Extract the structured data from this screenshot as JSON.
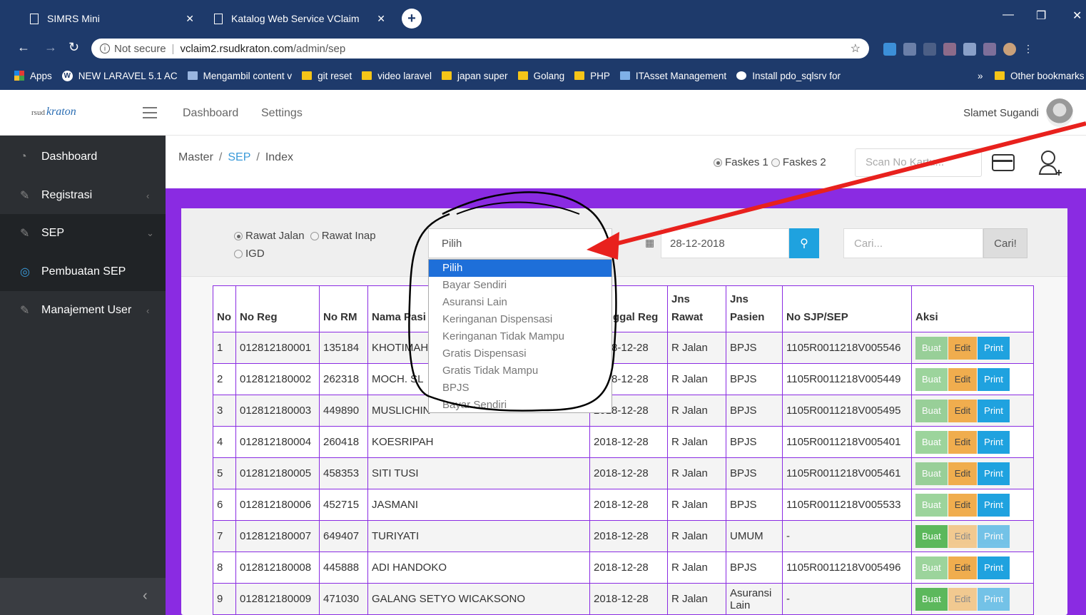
{
  "browser": {
    "tabs": [
      {
        "title": "SIMRS Mini"
      },
      {
        "title": "Katalog Web Service VClaim"
      }
    ],
    "address": {
      "security": "Not secure",
      "host": "vclaim2.rsudkraton.com",
      "path": "/admin/sep"
    },
    "bookmarks": [
      "Apps",
      "NEW LARAVEL 5.1 AC",
      "Mengambil content v",
      "git reset",
      "video laravel",
      "japan super",
      "Golang",
      "PHP",
      "ITAsset Management",
      "Install pdo_sqlsrv for"
    ],
    "other_bookmarks": "Other bookmarks",
    "overflow": "»"
  },
  "topnav": {
    "logo_small": "rsud",
    "logo": "kraton",
    "links": [
      "Dashboard",
      "Settings"
    ],
    "user": "Slamet Sugandi"
  },
  "sidebar": {
    "items": [
      {
        "label": "Dashboard"
      },
      {
        "label": "Registrasi"
      },
      {
        "label": "SEP"
      },
      {
        "label": "Pembuatan SEP"
      },
      {
        "label": "Manajement User"
      }
    ],
    "collapse": "‹"
  },
  "breadcrumb": {
    "master": "Master",
    "sep": "SEP",
    "index": "Index"
  },
  "faskes": {
    "options": [
      "Faskes 1",
      "Faskes 2"
    ],
    "selected": "Faskes 1"
  },
  "scan": {
    "placeholder": "Scan No Kartu..."
  },
  "filters": {
    "rawat": {
      "options": [
        "Rawat Jalan",
        "Rawat Inap",
        "IGD"
      ],
      "selected": "Rawat Jalan"
    },
    "select_value": "Pilih",
    "dropdown": [
      "Pilih",
      "Bayar Sendiri",
      "Asuransi Lain",
      "Keringanan Dispensasi",
      "Keringanan Tidak Mampu",
      "Gratis Dispensasi",
      "Gratis Tidak Mampu",
      "BPJS",
      "Bayar Sendiri"
    ],
    "date": "28-12-2018",
    "cari_placeholder": "Cari...",
    "cari_button": "Cari!"
  },
  "table": {
    "headers": [
      "No",
      "No Reg",
      "No RM",
      "Nama Pasien",
      "Tanggal Reg",
      "Jns Rawat",
      "Jns Pasien",
      "No SJP/SEP",
      "Aksi"
    ],
    "header_visible": [
      "No",
      "No Reg",
      "No RM",
      "Nama Pasi",
      "ggal Reg",
      "Jns Rawat",
      "Jns Pasien",
      "No SJP/SEP",
      "Aksi"
    ],
    "rows": [
      {
        "no": "1",
        "reg": "012812180001",
        "rm": "135184",
        "nama": "KHOTIMAH",
        "tgl": "2018-12-28",
        "rawat": "R Jalan",
        "pasien": "BPJS",
        "sep": "1105R0011218V005546"
      },
      {
        "no": "2",
        "reg": "012812180002",
        "rm": "262318",
        "nama": "MOCH. SL",
        "tgl": "2018-12-28",
        "rawat": "R Jalan",
        "pasien": "BPJS",
        "sep": "1105R0011218V005449"
      },
      {
        "no": "3",
        "reg": "012812180003",
        "rm": "449890",
        "nama": "MUSLICHIN",
        "tgl": "2018-12-28",
        "rawat": "R Jalan",
        "pasien": "BPJS",
        "sep": "1105R0011218V005495"
      },
      {
        "no": "4",
        "reg": "012812180004",
        "rm": "260418",
        "nama": "KOESRIPAH",
        "tgl": "2018-12-28",
        "rawat": "R Jalan",
        "pasien": "BPJS",
        "sep": "1105R0011218V005401"
      },
      {
        "no": "5",
        "reg": "012812180005",
        "rm": "458353",
        "nama": "SITI TUSI",
        "tgl": "2018-12-28",
        "rawat": "R Jalan",
        "pasien": "BPJS",
        "sep": "1105R0011218V005461"
      },
      {
        "no": "6",
        "reg": "012812180006",
        "rm": "452715",
        "nama": "JASMANI",
        "tgl": "2018-12-28",
        "rawat": "R Jalan",
        "pasien": "BPJS",
        "sep": "1105R0011218V005533"
      },
      {
        "no": "7",
        "reg": "012812180007",
        "rm": "649407",
        "nama": "TURIYATI",
        "tgl": "2018-12-28",
        "rawat": "R Jalan",
        "pasien": "UMUM",
        "sep": "-"
      },
      {
        "no": "8",
        "reg": "012812180008",
        "rm": "445888",
        "nama": "ADI HANDOKO",
        "tgl": "2018-12-28",
        "rawat": "R Jalan",
        "pasien": "BPJS",
        "sep": "1105R0011218V005496"
      },
      {
        "no": "9",
        "reg": "012812180009",
        "rm": "471030",
        "nama": "GALANG SETYO WICAKSONO",
        "tgl": "2018-12-28",
        "rawat": "R Jalan",
        "pasien": "Asuransi Lain",
        "sep": "-"
      }
    ],
    "actions": {
      "buat": "Buat",
      "edit": "Edit",
      "print": "Print"
    }
  },
  "colors": {
    "accent": "#8a2be2",
    "info": "#1fa2df",
    "success": "#5cb85c",
    "warning": "#f0ad4e",
    "sidebar": "#2c2f33",
    "annotation": "#e8211d"
  }
}
